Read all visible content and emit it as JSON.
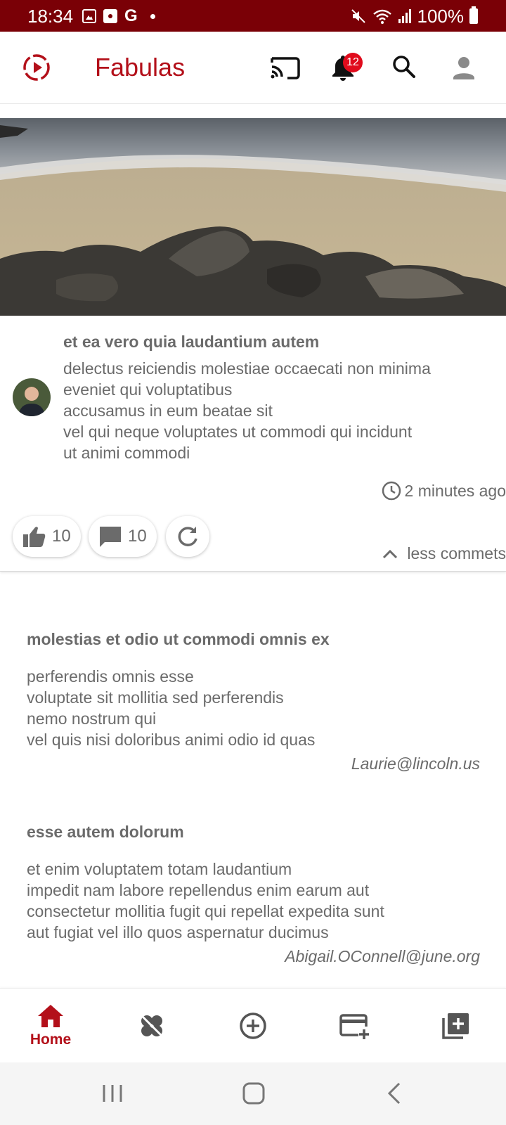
{
  "status_bar": {
    "time": "18:34",
    "g_label": "G",
    "battery": "100%"
  },
  "app_bar": {
    "title": "Fabulas",
    "notification_count": "12",
    "icons": [
      "logo-play-icon",
      "cast-icon",
      "bell-icon",
      "search-icon",
      "account-icon"
    ]
  },
  "post": {
    "title": "et ea vero quia laudantium autem",
    "body_lines": [
      "delectus reiciendis molestiae occaecati non minima",
      "eveniet qui voluptatibus",
      "accusamus in eum beatae sit",
      "vel qui neque voluptates ut commodi qui incidunt",
      "ut animi commodi"
    ],
    "time_ago": "2 minutes ago",
    "likes": "10",
    "comments": "10",
    "less_comments_label": "less commets"
  },
  "comments": [
    {
      "title": "molestias et odio ut commodi omnis ex",
      "body_lines": [
        "perferendis omnis esse",
        "voluptate sit mollitia sed perferendis",
        "nemo nostrum qui",
        "vel quis nisi doloribus animi odio id quas"
      ],
      "email": "Laurie@lincoln.us"
    },
    {
      "title": "esse autem dolorum",
      "body_lines": [
        "et enim voluptatem totam laudantium",
        "impedit nam labore repellendus enim earum aut",
        "consectetur mollitia fugit qui repellat expedita sunt",
        "aut fugiat vel illo quos aspernatur ducimus"
      ],
      "email": "Abigail.OConnell@june.org"
    }
  ],
  "bottom_nav": {
    "home_label": "Home",
    "icons": [
      "home-icon",
      "clover-icon",
      "add-circle-icon",
      "add-card-icon",
      "add-library-icon"
    ]
  },
  "colors": {
    "brand": "#b3101a",
    "status_bar": "#7a0006",
    "badge": "#e00b1c",
    "text": "#6b6b6b"
  }
}
